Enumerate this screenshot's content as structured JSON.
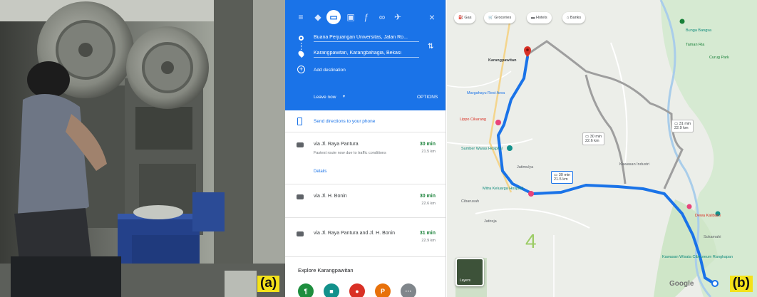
{
  "labels": {
    "panel_a": "(a)",
    "panel_b": "(b)"
  },
  "sidebar": {
    "travel_modes": [
      "menu-icon",
      "best-route-icon",
      "car-icon",
      "transit-icon",
      "walk-icon",
      "bike-icon",
      "flight-icon"
    ],
    "origin": "Buana Perjuangan Universitas, Jalan Ro...",
    "destination": "Karangpawitan, Karangbahagia, Bekasi",
    "add_destination": "Add destination",
    "leave_now": "Leave now",
    "options": "OPTIONS",
    "send_directions": "Send directions to your phone",
    "routes": [
      {
        "via": "via Jl. Raya Pantura",
        "time": "30 min",
        "distance": "21.5 km",
        "note": "Fastest route now due to traffic conditions",
        "details": "Details"
      },
      {
        "via": "via Jl. H. Bonin",
        "time": "30 min",
        "distance": "22.6 km"
      },
      {
        "via": "via Jl. Raya Pantura and Jl. H. Bonin",
        "time": "31 min",
        "distance": "22.9 km"
      }
    ],
    "explore_title": "Explore Karangpawitan",
    "explore_buttons": [
      {
        "glyph": "¶",
        "color": "#1e8e3e"
      },
      {
        "glyph": "■",
        "color": "#12918b"
      },
      {
        "glyph": "●",
        "color": "#d93025"
      },
      {
        "glyph": "P",
        "color": "#e8710a"
      },
      {
        "glyph": "···",
        "color": "#80868b"
      }
    ]
  },
  "map": {
    "chips": [
      "Gas",
      "Groceries",
      "Hotels",
      "Banks"
    ],
    "places": [
      {
        "name": "Karangpawitan",
        "color": "#3c4043"
      },
      {
        "name": "Margahayu Rest Area",
        "color": "#1a73e8"
      },
      {
        "name": "Sumber Waras Hospital",
        "color": "#0e8a7b"
      },
      {
        "name": "Lippo Cikarang",
        "color": "#d93025"
      },
      {
        "name": "Mitra Keluarga Hospital",
        "color": "#0e8a7b"
      },
      {
        "name": "Jatimulya",
        "color": "#5f6368"
      },
      {
        "name": "Jatireja",
        "color": "#5f6368"
      },
      {
        "name": "Cibarusah",
        "color": "#5f6368"
      },
      {
        "name": "Kawasan Industri",
        "color": "#5f6368"
      },
      {
        "name": "Bunga Bangsa",
        "color": "#0e8a7b"
      },
      {
        "name": "Curug Park",
        "color": "#188038"
      },
      {
        "name": "Taman Ria",
        "color": "#188038"
      },
      {
        "name": "Sukamahi",
        "color": "#5f6368"
      },
      {
        "name": "Kawasan Wisata Cibeureum Rangkapan",
        "color": "#0e8a7b"
      },
      {
        "name": "Dewa Kalibaru",
        "color": "#d93025"
      }
    ],
    "etas": [
      {
        "time": "30 min",
        "dist": "21.5 km"
      },
      {
        "time": "30 min",
        "dist": "22.6 km"
      },
      {
        "time": "31 min",
        "dist": "22.9 km"
      }
    ],
    "layers": "Layers",
    "brand": "Google"
  }
}
